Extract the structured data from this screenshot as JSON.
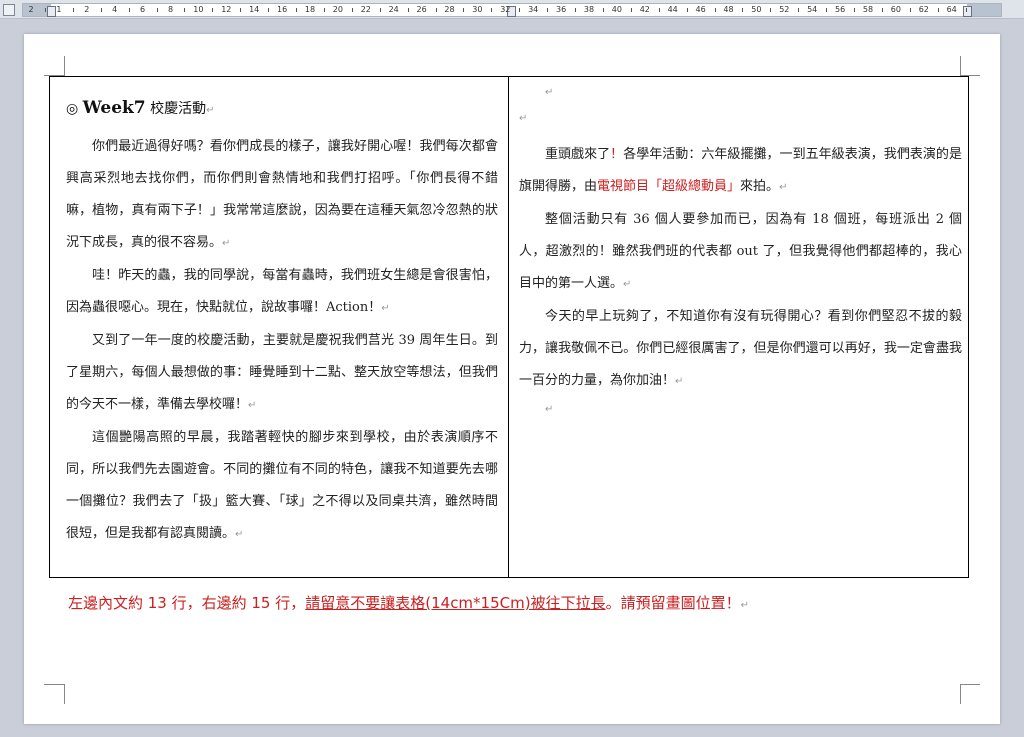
{
  "ruler": {
    "labels": [
      "2",
      "1",
      "2",
      "4",
      "6",
      "8",
      "10",
      "12",
      "14",
      "16",
      "18",
      "20",
      "22",
      "24",
      "26",
      "28",
      "30",
      "32",
      "34",
      "36",
      "38",
      "40",
      "42",
      "44",
      "46",
      "48",
      "50",
      "52",
      "54",
      "56",
      "58",
      "60",
      "62",
      "64"
    ]
  },
  "left": {
    "heading_symbol": "◎",
    "heading_week": "Week7",
    "heading_title": "校慶活動",
    "p1": "你們最近過得好嗎？看你們成長的樣子，讓我好開心喔！我們每次都會興高采烈地去找你們，而你們則會熱情地和我們打招呼。「你們長得不錯嘛，植物，真有兩下子！」我常常這麼說，因為要在這種天氣忽冷忽熱的狀況下成長，真的很不容易。",
    "p2": "哇！昨天的蟲，我的同學說，每當有蟲時，我們班女生總是會很害怕，因為蟲很噁心。現在，快點就位，說故事囉！Action！",
    "p3": "又到了一年一度的校慶活動，主要就是慶祝我們莒光 39 周年生日。到了星期六，每個人最想做的事：睡覺睡到十二點、整天放空等想法，但我們的今天不一樣，準備去學校囉！",
    "p4": "這個艷陽高照的早晨，我踏著輕快的腳步來到學校，由於表演順序不同，所以我們先去園遊會。不同的攤位有不同的特色，讓我不知道要先去哪一個攤位？我們去了「扱」籃大賽、「球」之不得以及同桌共濟，雖然時間很短，但是我都有認真閱讀。"
  },
  "right": {
    "p1_a": "重頭戲來了",
    "p1_b": "！",
    "p1_c": "各學年活動",
    "p1_d": "：六年級擺攤，一到五年級表演，我們表演的是旗開得勝，由",
    "p1_e": "電視節目",
    "p1_f": "「超級總動員」",
    "p1_g": "來拍。",
    "p2_a": "整個活動只有 36 個人要參加而已，因為有 18 個班，每班派出 2 個人",
    "p2_b": "，超激烈的！雖然我們班的代表都 out 了，但我覺得他們都超棒的，我心目中的第一人選。",
    "p3": "今天的早上玩夠了，不知道你有沒有玩得開心？看到你們堅忍不拔的毅力，讓我敬佩不已。你們已經很厲害了，但是你們還可以再好，我一定會盡我一百分的力量，為你加油！"
  },
  "note": {
    "a": "左邊內文約 13 行，右邊約 15 行，",
    "b": "請留意不要讓表格(14cm*15Cm)被往下拉長",
    "c": "。請預留畫圖位置！"
  },
  "colors": {
    "accent_red": "#cc1f1f"
  }
}
